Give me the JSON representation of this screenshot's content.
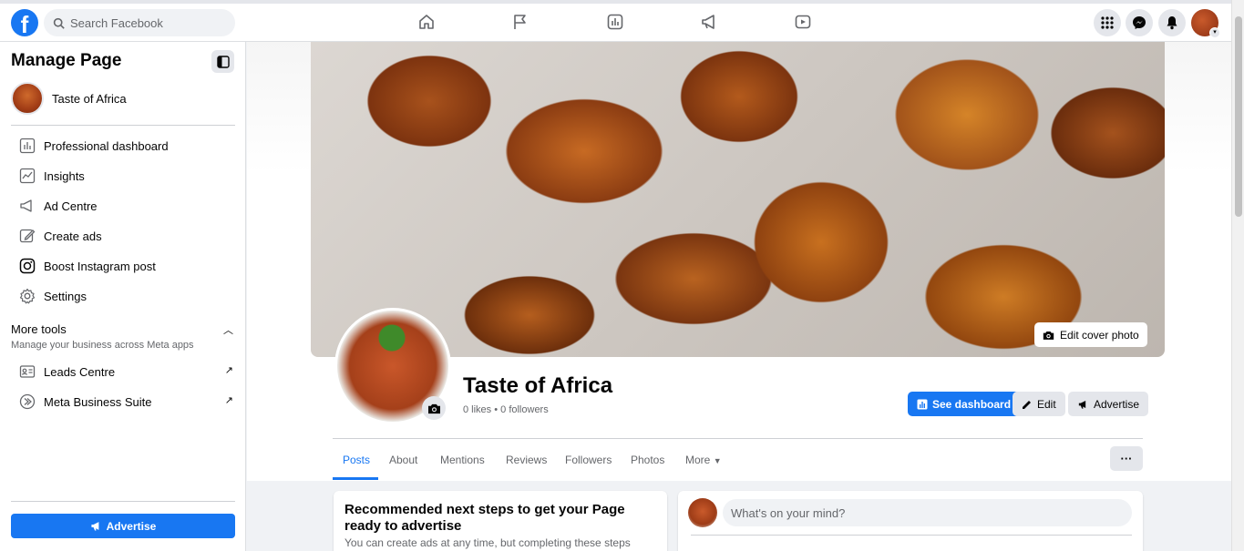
{
  "topbar": {
    "logo": "f",
    "search_placeholder": "Search Facebook",
    "nav_icons": [
      "home-icon",
      "flag-icon",
      "insights-icon",
      "megaphone-icon",
      "video-icon"
    ],
    "right_icons": [
      "menu-grid-icon",
      "messenger-icon",
      "bell-icon"
    ]
  },
  "sidebar": {
    "title": "Manage Page",
    "page_name": "Taste of Africa",
    "items": [
      {
        "label": "Professional dashboard",
        "icon": "dashboard-icon"
      },
      {
        "label": "Insights",
        "icon": "insights-icon"
      },
      {
        "label": "Ad Centre",
        "icon": "megaphone-icon"
      },
      {
        "label": "Create ads",
        "icon": "pencil-icon"
      },
      {
        "label": "Boost Instagram post",
        "icon": "instagram-icon"
      },
      {
        "label": "Settings",
        "icon": "gear-icon"
      }
    ],
    "more_tools": {
      "title": "More tools",
      "subtitle": "Manage your business across Meta apps"
    },
    "tools": [
      {
        "label": "Leads Centre",
        "icon": "leads-icon"
      },
      {
        "label": "Meta Business Suite",
        "icon": "meta-business-icon"
      }
    ],
    "advertise_label": "Advertise"
  },
  "page": {
    "name": "Taste of Africa",
    "stats": "0 likes • 0 followers",
    "edit_cover_label": "Edit cover photo",
    "see_dashboard_label": "See dashboard",
    "edit_label": "Edit",
    "advertise_label": "Advertise",
    "tabs": [
      "Posts",
      "About",
      "Mentions",
      "Reviews",
      "Followers",
      "Photos",
      "More"
    ],
    "more_dots": "···"
  },
  "recommended": {
    "title": "Recommended next steps to get your Page ready to advertise",
    "desc": "You can create ads at any time, but completing these steps"
  },
  "composer": {
    "placeholder": "What's on your mind?"
  },
  "colors": {
    "brand": "#1877f2",
    "background": "#f0f2f5"
  }
}
